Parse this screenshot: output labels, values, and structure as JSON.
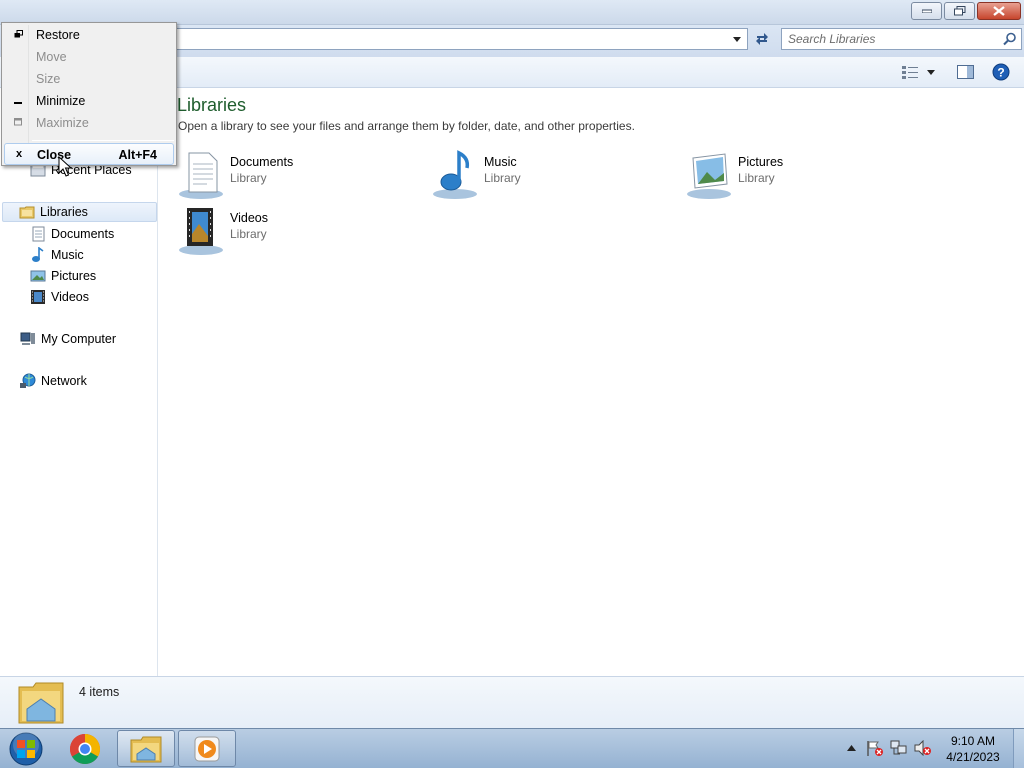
{
  "window": {
    "caption_buttons": [
      "minimize",
      "restore",
      "close"
    ]
  },
  "address": {
    "path": "",
    "dropdown_icon": "chevron-down-icon",
    "refresh_icon": "refresh-icon"
  },
  "search": {
    "placeholder": "Search Libraries",
    "icon": "search-icon"
  },
  "toolbar": {
    "icons": [
      "change-view-icon",
      "more-options-chevron-icon",
      "preview-pane-icon",
      "help-icon"
    ]
  },
  "nav": {
    "recent_places": "Recent Places",
    "libraries": "Libraries",
    "documents": "Documents",
    "music": "Music",
    "pictures": "Pictures",
    "videos": "Videos",
    "my_computer": "My Computer",
    "network": "Network"
  },
  "main": {
    "title": "Libraries",
    "subtitle": "Open a library to see your files and arrange them by folder, date, and other properties.",
    "libraries": [
      {
        "name": "Documents",
        "type": "Library"
      },
      {
        "name": "Music",
        "type": "Library"
      },
      {
        "name": "Pictures",
        "type": "Library"
      },
      {
        "name": "Videos",
        "type": "Library"
      }
    ]
  },
  "details": {
    "count": "4 items"
  },
  "system_menu": {
    "items": [
      {
        "label": "Restore",
        "icon": "restore-icon",
        "enabled": true
      },
      {
        "label": "Move",
        "enabled": false
      },
      {
        "label": "Size",
        "enabled": false
      },
      {
        "label": "Minimize",
        "icon": "minimize-icon",
        "enabled": true
      },
      {
        "label": "Maximize",
        "icon": "maximize-icon",
        "enabled": false
      },
      {
        "label": "Close",
        "icon_glyph": "x",
        "accelerator": "Alt+F4",
        "enabled": true,
        "highlighted": true
      }
    ]
  },
  "taskbar": {
    "apps": [
      "chrome",
      "windows-explorer",
      "media-player"
    ],
    "tray_icons": [
      "show-hidden-icons",
      "action-center-flag-icon",
      "network-icon",
      "volume-muted-icon"
    ],
    "time": "9:10 AM",
    "date": "4/21/2023"
  },
  "colors": {
    "title_green": "#1e5d2d",
    "chrome_blue": "#cfdcee",
    "taskbar": "#a9c1dc"
  }
}
